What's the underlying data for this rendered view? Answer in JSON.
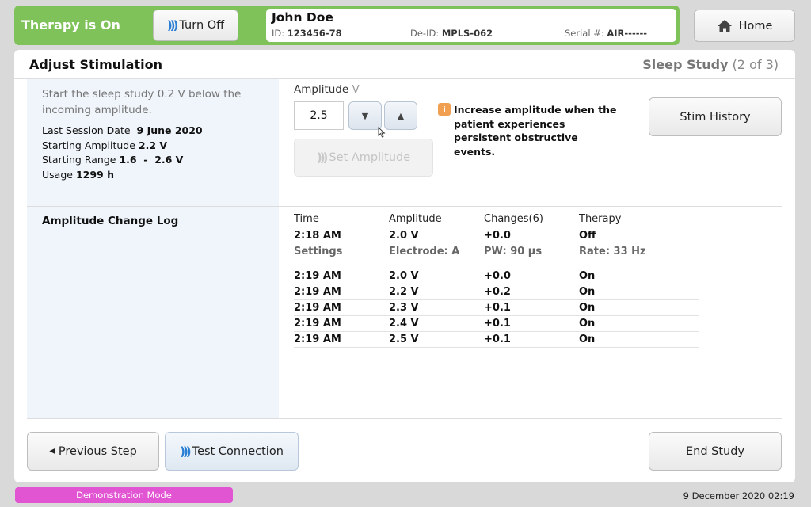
{
  "header": {
    "therapy_status": "Therapy is On",
    "turn_off_label": "Turn Off",
    "home_label": "Home",
    "patient": {
      "name": "John Doe",
      "id_label": "ID:",
      "id_value": "123456-78",
      "deid_label": "De-ID:",
      "deid_value": "MPLS-062",
      "serial_label": "Serial #:",
      "serial_value": "AIR------"
    }
  },
  "panel": {
    "title": "Adjust Stimulation",
    "step_name": "Sleep Study",
    "step_progress": "(2 of 3)",
    "intro": "Start the sleep study 0.2 V below the incoming amplitude.",
    "info": [
      {
        "label": "Last Session Date",
        "value": "9 June 2020"
      },
      {
        "label": "Starting Amplitude",
        "value": "2.2 V"
      },
      {
        "label": "Starting Range",
        "value": "1.6  -  2.6 V"
      },
      {
        "label": "Usage",
        "value": "1299 h"
      }
    ],
    "amplitude_label": "Amplitude",
    "amplitude_unit": "V",
    "amplitude_value": "2.5",
    "down_glyph": "▼",
    "up_glyph": "▲",
    "set_amplitude_label": "Set Amplitude",
    "info_icon_glyph": "i",
    "hint": "Increase amplitude when the patient experiences persistent obstructive events.",
    "stim_history_label": "Stim History"
  },
  "log": {
    "title": "Amplitude Change Log",
    "headers": [
      "Time",
      "Amplitude",
      "Changes(6)",
      "Therapy"
    ],
    "first_row": [
      "2:18 AM",
      "2.0 V",
      "+0.0",
      "Off"
    ],
    "settings_row": [
      "Settings",
      "Electrode: A",
      "PW: 90 µs",
      "Rate: 33 Hz"
    ],
    "rows": [
      [
        "2:19 AM",
        "2.0 V",
        "+0.0",
        "On"
      ],
      [
        "2:19 AM",
        "2.2 V",
        "+0.2",
        "On"
      ],
      [
        "2:19 AM",
        "2.3 V",
        "+0.1",
        "On"
      ],
      [
        "2:19 AM",
        "2.4 V",
        "+0.1",
        "On"
      ],
      [
        "2:19 AM",
        "2.5 V",
        "+0.1",
        "On"
      ]
    ]
  },
  "footer": {
    "prev_label": "Previous Step",
    "test_label": "Test Connection",
    "end_label": "End Study",
    "demo_mode": "Demonstration Mode",
    "datetime": "9 December 2020 02:19"
  },
  "colors": {
    "therapy_on": "#7fc25a",
    "demo_mode": "#e155d2",
    "info_icon": "#f0a050",
    "wireless_icon": "#2a7fd4"
  }
}
